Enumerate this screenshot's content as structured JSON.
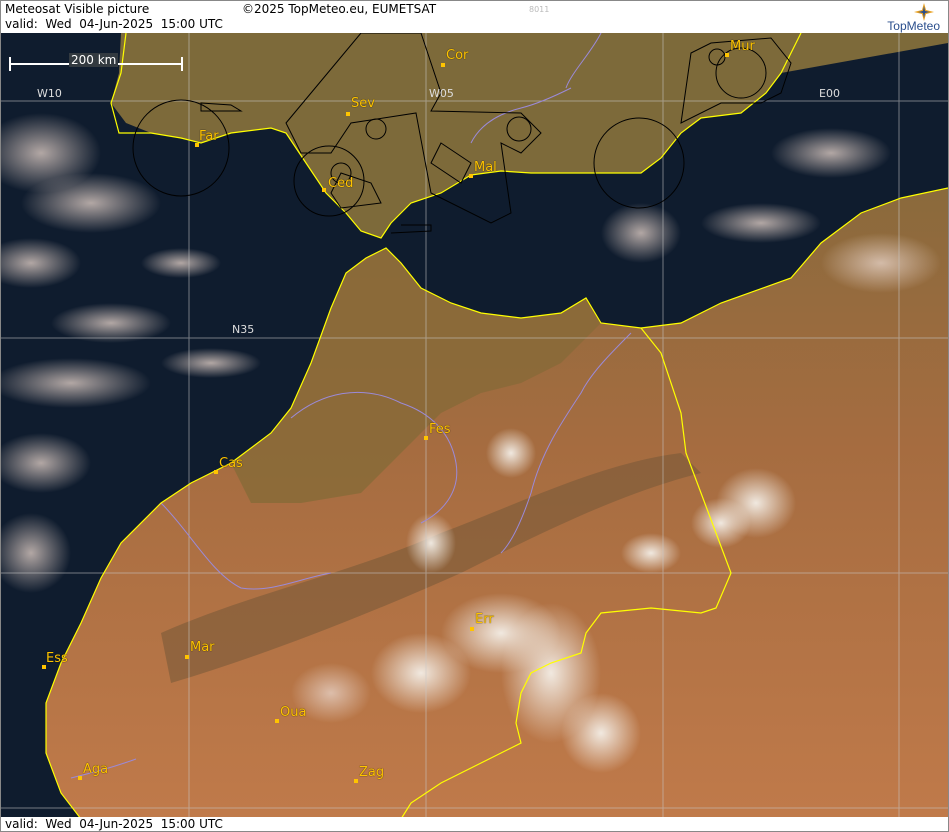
{
  "header": {
    "title": "Meteosat Visible picture",
    "valid": "valid:  Wed  04-Jun-2025  15:00 UTC",
    "copyright": "©2025 TopMeteo.eu, EUMETSAT",
    "code": "8011",
    "brand": "TopMeteo"
  },
  "footer": {
    "valid": "valid:  Wed  04-Jun-2025  15:00 UTC"
  },
  "scale": {
    "label": "200 km"
  },
  "grid_labels": {
    "w10": "W10",
    "w05": "W05",
    "e00": "E00",
    "n35": "N35"
  },
  "cities": {
    "cor": "Cor",
    "mur": "Mur",
    "sev": "Sev",
    "far": "Far",
    "ced": "Ced",
    "mal": "Mal",
    "fes": "Fes",
    "cas": "Cas",
    "err": "Err",
    "ess": "Ess",
    "mar": "Mar",
    "oua": "Oua",
    "aga": "Aga",
    "zag": "Zag"
  },
  "colors": {
    "sea": "#0e1a2c",
    "land": "#b06a3e",
    "coast": "#ffff00",
    "city": "#ffc400",
    "grid": "#c8c8c8"
  }
}
